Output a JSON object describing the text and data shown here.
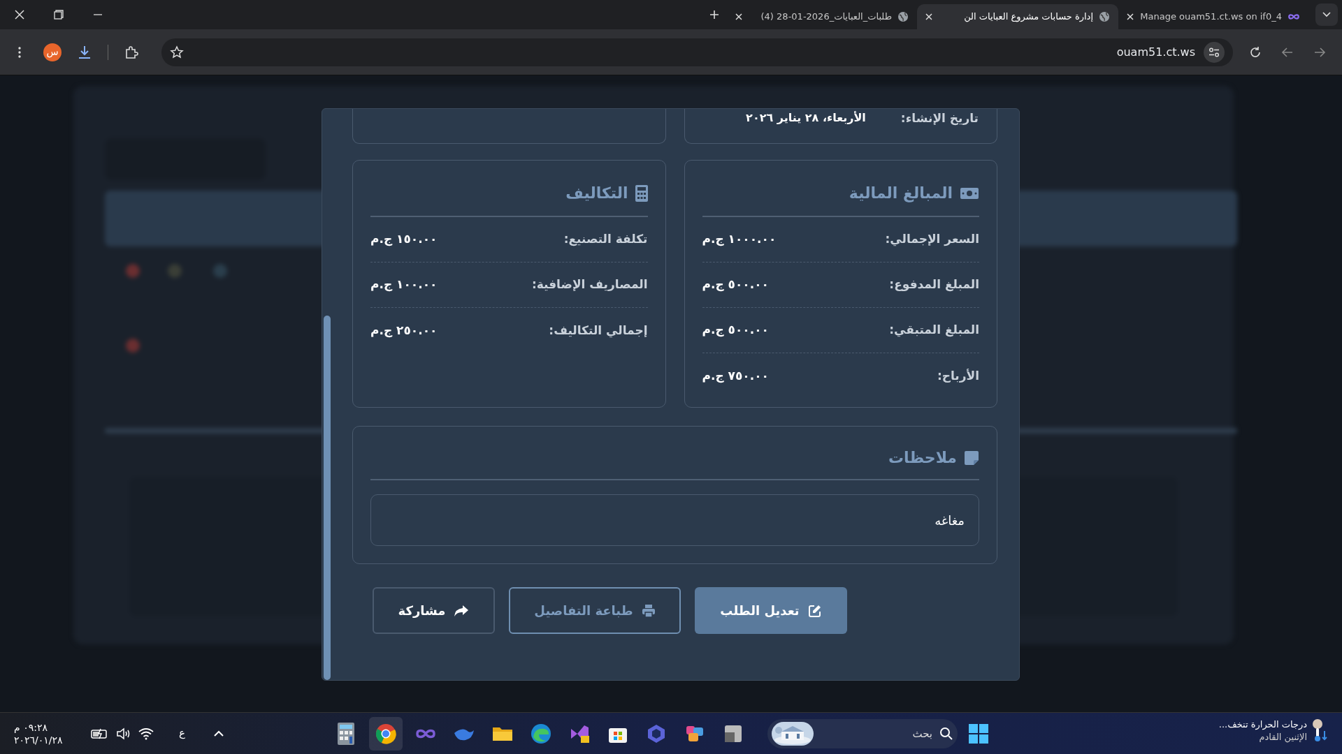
{
  "browser": {
    "tabs": [
      {
        "title": "Manage ouam51.ct.ws on if0_4",
        "selected": false
      },
      {
        "title": "إدارة حسابات مشروع العبايات الن",
        "selected": true
      },
      {
        "title": "طلبات_العبايات_2026-01-28 (4)",
        "selected": false
      }
    ],
    "address": "ouam51.ct.ws",
    "profile_initial": "س"
  },
  "dialog": {
    "created": {
      "label": "تاريخ الإنشاء:",
      "value": "الأربعاء، ٢٨ يناير ٢٠٢٦"
    },
    "sections": [
      {
        "title": "المبالغ المالية",
        "rows": [
          {
            "label": "السعر الإجمالي:",
            "value": "١٠٠٠.٠٠ ج.م"
          },
          {
            "label": "المبلغ المدفوع:",
            "value": "٥٠٠.٠٠ ج.م"
          },
          {
            "label": "المبلغ المتبقي:",
            "value": "٥٠٠.٠٠ ج.م"
          },
          {
            "label": "الأرباح:",
            "value": "٧٥٠.٠٠ ج.م"
          }
        ]
      },
      {
        "title": "التكاليف",
        "rows": [
          {
            "label": "تكلفة التصنيع:",
            "value": "١٥٠.٠٠ ج.م"
          },
          {
            "label": "المصاريف الإضافية:",
            "value": "١٠٠.٠٠ ج.م"
          },
          {
            "label": "إجمالي التكاليف:",
            "value": "٢٥٠.٠٠ ج.م"
          }
        ]
      }
    ],
    "notes": {
      "title": "ملاحظات",
      "text": "مغاغه"
    },
    "buttons": [
      {
        "label": "تعديل الطلب",
        "kind": "primary"
      },
      {
        "label": "طباعة التفاصيل",
        "kind": "outline"
      },
      {
        "label": "مشاركة",
        "kind": "plain"
      }
    ]
  },
  "taskbar": {
    "time": "٠٩:٢٨ م",
    "date": "٢٠٢٦/٠١/٢٨",
    "language": "ع",
    "search_placeholder": "بحث",
    "weather_title": "درجات الحرارة تنخف...",
    "weather_subtitle": "الإثنين القادم"
  }
}
